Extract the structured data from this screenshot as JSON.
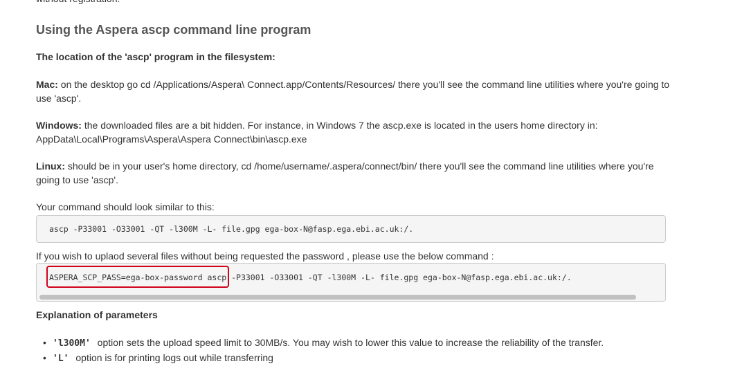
{
  "top_cut_text": "without registration.",
  "section_title": "Using the Aspera ascp command line program",
  "location_heading": "The location of the 'ascp' program in the filesystem:",
  "mac": {
    "label": "Mac:",
    "text": " on the desktop go cd /Applications/Aspera\\ Connect.app/Contents/Resources/ there you'll see the command line utilities where you're going to use 'ascp'."
  },
  "windows": {
    "label": "Windows:",
    "text": " the downloaded files are a bit hidden. For instance, in Windows 7 the ascp.exe is located in the users home directory in: AppData\\Local\\Programs\\Aspera\\Aspera Connect\\bin\\ascp.exe"
  },
  "linux": {
    "label": "Linux:",
    "text": " should be in your user's home directory, cd /home/username/.aspera/connect/bin/ there you'll see the command line utilities where you're going to use 'ascp'."
  },
  "command_intro": "Your command should look similar to this:",
  "command1": "ascp -P33001 -O33001 -QT -l300M -L- file.gpg ega-box-N@fasp.ega.ebi.ac.uk:/.",
  "command2_intro": "If you wish to uplaod several files without being requested the password , please use the below command :",
  "command2": "ASPERA_SCP_PASS=ega-box-password ascp -P33001  -O33001 -QT -l300M -L- file.gpg ega-box-N@fasp.ega.ebi.ac.uk:/.",
  "params_heading": "Explanation of parameters",
  "params": [
    {
      "flag": "'l300M'",
      "text": " option sets the upload speed limit to 30MB/s. You may wish to lower this value to increase the reliability of the transfer."
    },
    {
      "flag": "'L'",
      "text": " option is for printing logs out while transferring"
    }
  ],
  "colors": {
    "text": "#333333",
    "heading": "#555555",
    "code_bg": "#f5f5f5",
    "code_border": "#cccccc",
    "highlight": "#d0021b",
    "scroll_thumb": "#c1c1c1"
  }
}
